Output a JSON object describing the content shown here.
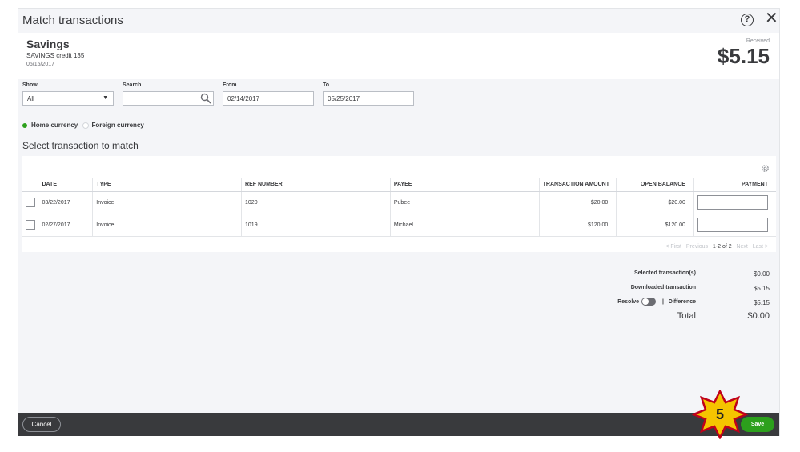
{
  "dialog": {
    "title": "Match transactions"
  },
  "account": {
    "name": "Savings",
    "description": "SAVINGS credit 135",
    "date": "05/15/2017",
    "received_label": "Received",
    "amount": "$5.15"
  },
  "filters": {
    "show_label": "Show",
    "show_value": "All",
    "search_label": "Search",
    "search_value": "",
    "from_label": "From",
    "from_value": "02/14/2017",
    "to_label": "To",
    "to_value": "05/25/2017"
  },
  "currency": {
    "home": "Home currency",
    "foreign": "Foreign currency"
  },
  "section_title": "Select transaction to match",
  "table": {
    "headers": [
      "DATE",
      "TYPE",
      "REF NUMBER",
      "PAYEE",
      "TRANSACTION AMOUNT",
      "OPEN BALANCE",
      "PAYMENT"
    ],
    "rows": [
      {
        "date": "03/22/2017",
        "type": "Invoice",
        "ref": "1020",
        "payee": "Pubee",
        "amount": "$20.00",
        "balance": "$20.00"
      },
      {
        "date": "02/27/2017",
        "type": "Invoice",
        "ref": "1019",
        "payee": "Michael",
        "amount": "$120.00",
        "balance": "$120.00"
      }
    ]
  },
  "pager": {
    "first": "< First",
    "previous": "Previous",
    "range": "1-2 of 2",
    "next": "Next",
    "last": "Last >"
  },
  "summary": {
    "selected_label": "Selected transaction(s)",
    "selected_value": "$0.00",
    "downloaded_label": "Downloaded transaction",
    "downloaded_value": "$5.15",
    "resolve_label": "Resolve",
    "separator": "|",
    "difference_label": "Difference",
    "difference_value": "$5.15",
    "total_label": "Total",
    "total_value": "$0.00"
  },
  "footer": {
    "cancel": "Cancel",
    "save": "Save"
  },
  "callout": {
    "number": "5",
    "color": "#f5c400",
    "border_color": "#c0001a"
  },
  "colors": {
    "accent": "#2ca01c",
    "footer": "#393a3d",
    "panel": "#f4f5f8"
  },
  "icons": [
    "help-icon",
    "close-icon",
    "chevron-down-icon",
    "search-icon",
    "gear-icon"
  ]
}
